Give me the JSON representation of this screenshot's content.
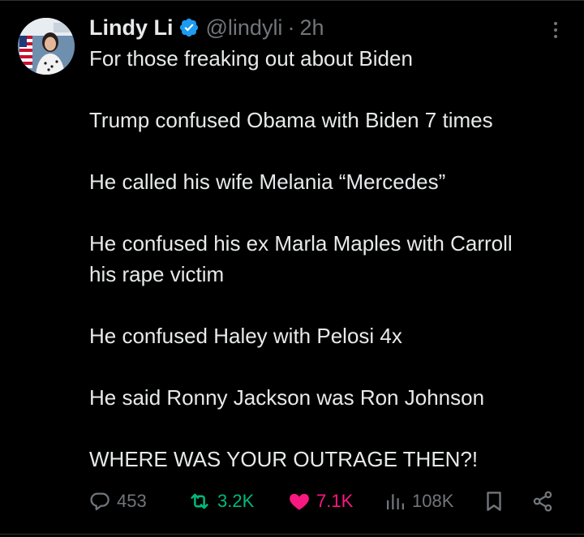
{
  "tweet": {
    "author_name": "Lindy Li",
    "handle": "@lindyli",
    "separator": "·",
    "time": "2h",
    "paragraphs": [
      [
        "For those freaking out about Biden"
      ],
      [
        "Trump confused Obama with Biden 7 times"
      ],
      [
        "He called his wife Melania “Mercedes”"
      ],
      [
        "He confused his ex Marla Maples with Carroll",
        "his rape victim"
      ],
      [
        "He confused Haley with Pelosi 4x"
      ],
      [
        "He said Ronny Jackson was Ron Johnson"
      ],
      [
        "WHERE WAS YOUR OUTRAGE THEN?!"
      ]
    ],
    "stats": {
      "replies": "453",
      "reposts": "3.2K",
      "likes": "7.1K",
      "views": "108K"
    }
  },
  "icons": {
    "avatar": "profile-photo",
    "verified": "verified-badge-icon",
    "more": "more-options-icon",
    "reply": "reply-icon",
    "repost": "repost-icon",
    "like": "heart-icon",
    "views": "views-chart-icon",
    "bookmark": "bookmark-icon",
    "share": "share-icon"
  },
  "colors": {
    "background": "#000000",
    "text": "#e7e9ea",
    "muted": "#71767b",
    "verified": "#1d9bf0",
    "repost_active": "#00ba7c",
    "like_active": "#f91880"
  }
}
